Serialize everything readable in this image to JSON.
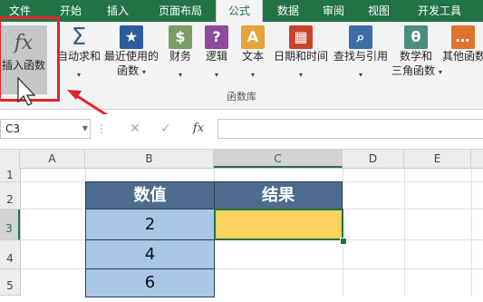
{
  "ribbon_tabs": [
    "文件",
    "开始",
    "插入",
    "页面布局",
    "公式",
    "数据",
    "审阅",
    "视图",
    "开发工具"
  ],
  "active_tab": "公式",
  "function_library": {
    "insert_function": {
      "line1": "插入函数",
      "icon": "fx-icon",
      "glyph": "fx"
    },
    "autosum": {
      "line1": "自动求和",
      "icon": "sigma-icon",
      "glyph": "Σ"
    },
    "recently_used": {
      "line1": "最近使用的",
      "line2": "函数",
      "icon": "star-book-icon",
      "glyph": "★"
    },
    "financial": {
      "line1": "财务",
      "icon": "coins-book-icon",
      "glyph": "$"
    },
    "logical": {
      "line1": "逻辑",
      "icon": "question-book-icon",
      "glyph": "?"
    },
    "text": {
      "line1": "文本",
      "icon": "letter-a-book-icon",
      "glyph": "A"
    },
    "date_time": {
      "line1": "日期和时间",
      "icon": "calendar-book-icon",
      "glyph": "▦"
    },
    "lookup_reference": {
      "line1": "查找与引用",
      "icon": "magnifier-book-icon",
      "glyph": "⌕"
    },
    "math_trig": {
      "line1": "数学和",
      "line2": "三角函数",
      "icon": "theta-book-icon",
      "glyph": "θ"
    },
    "more_functions": {
      "line1": "其他函数",
      "icon": "more-book-icon",
      "glyph": "…"
    },
    "group_label": "函数库"
  },
  "formula_bar": {
    "name_box": "C3",
    "cancel_glyph": "✕",
    "enter_glyph": "✓",
    "fx_glyph": "fx",
    "formula": ""
  },
  "columns": [
    "A",
    "B",
    "C",
    "D",
    "E"
  ],
  "rows": [
    "1",
    "2",
    "3",
    "4",
    "5"
  ],
  "selected_cell": "C3",
  "table": {
    "header_b": "数值",
    "header_c": "结果",
    "values": [
      "2",
      "4",
      "6"
    ]
  },
  "colors": {
    "excel_green": "#217346",
    "table_header": "#4d6c8e",
    "table_values": "#a8c6e6",
    "result_cell": "#fcd35d",
    "annotation_red": "#e0262d"
  }
}
